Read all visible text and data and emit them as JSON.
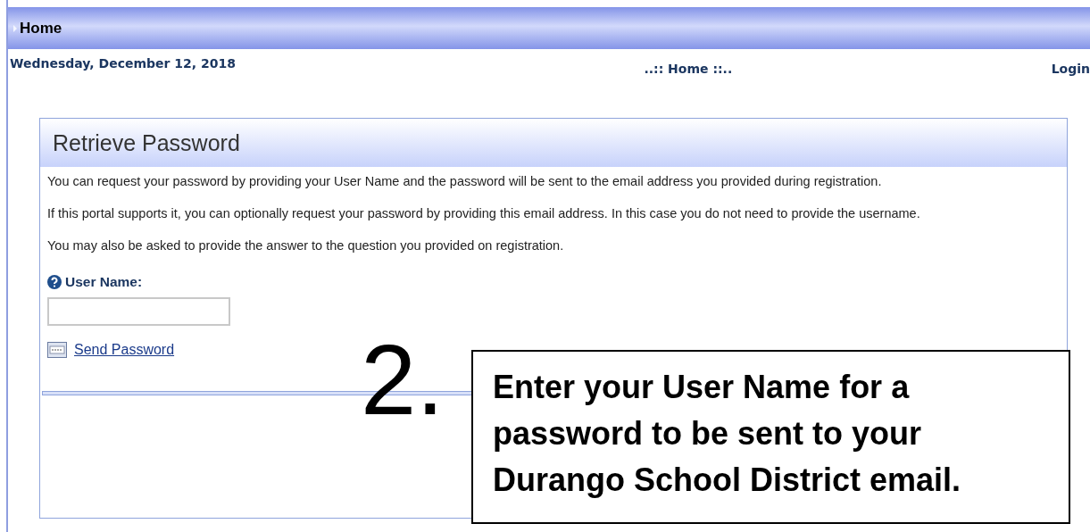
{
  "nav_bar": {
    "title": "Home"
  },
  "info_bar": {
    "date": "Wednesday, December 12, 2018",
    "page_title": "..:: Home ::..",
    "login": "Login"
  },
  "panel": {
    "title": "Retrieve Password",
    "paragraphs": [
      "You can request your password by providing your User Name and the password will be sent to the email address you provided during registration.",
      "If this portal supports it, you can optionally request your password by providing this email address. In this case you do not need to provide the username.",
      "You may also be asked to provide the answer to the question you provided on registration."
    ],
    "field_label": "User Name:",
    "send_link": "Send Password"
  },
  "annotation": {
    "step": "2.",
    "text": "Enter your User Name for a password to be sent to your Durango School District email."
  }
}
